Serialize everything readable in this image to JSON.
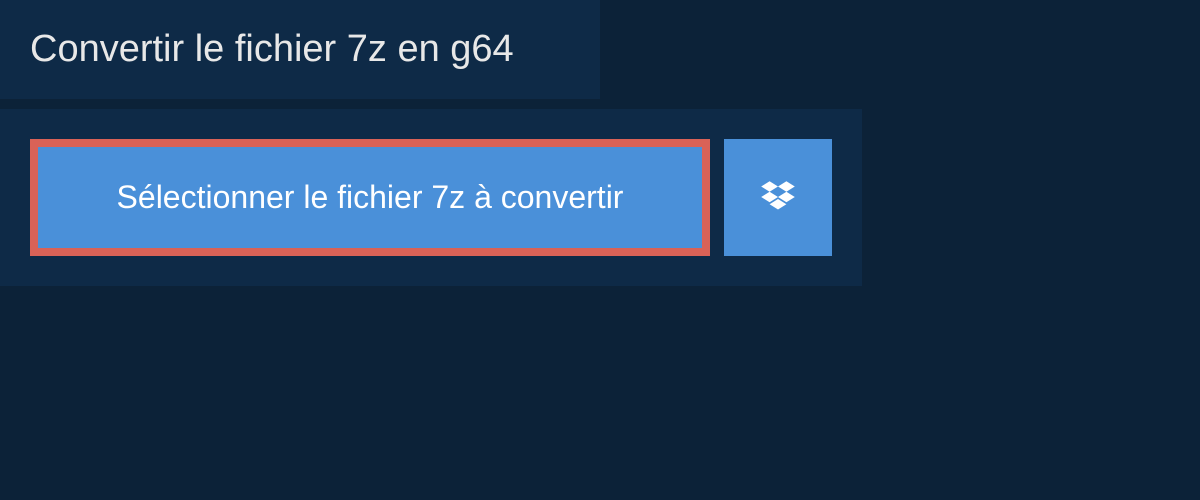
{
  "header": {
    "title": "Convertir le fichier 7z en g64"
  },
  "upload": {
    "select_button_label": "Sélectionner le fichier 7z à convertir"
  }
}
